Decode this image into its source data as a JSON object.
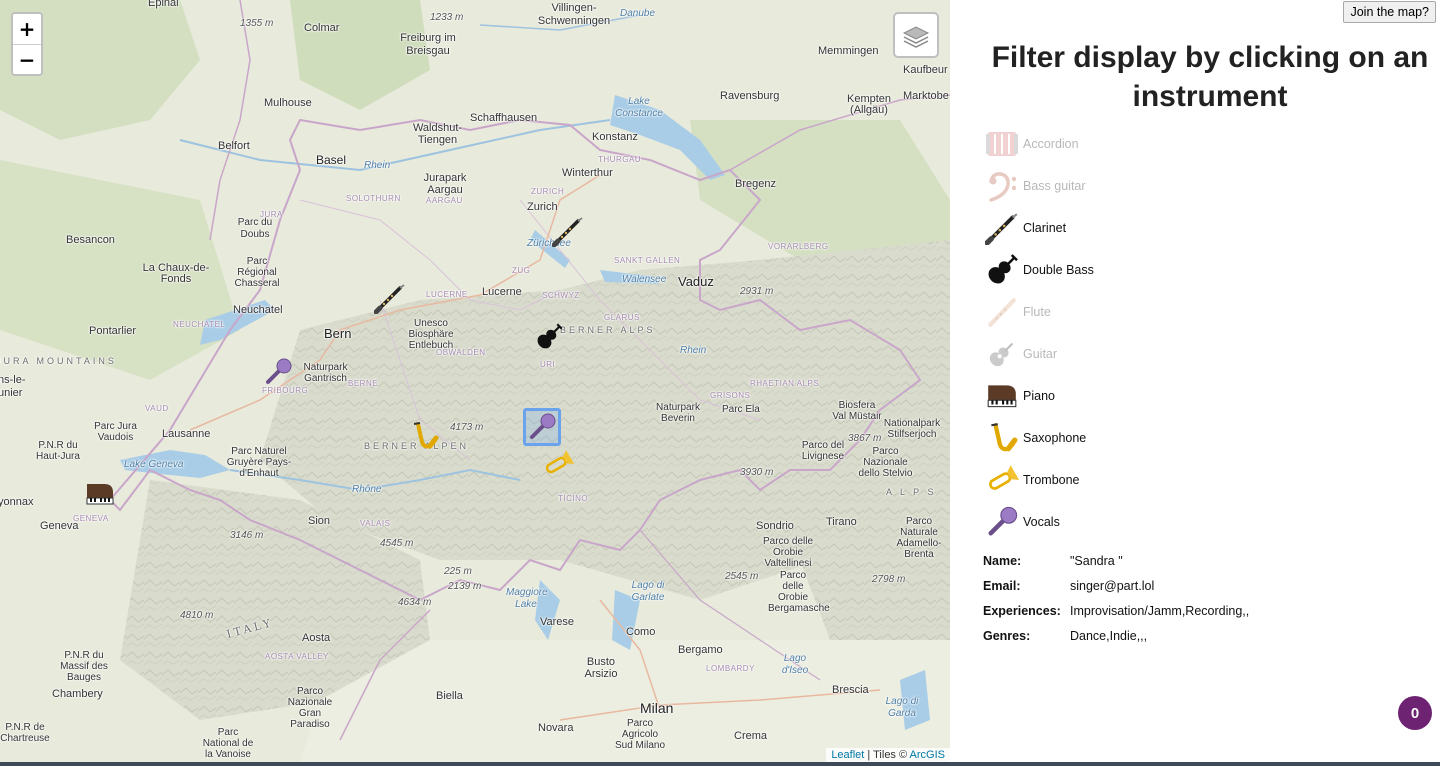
{
  "map": {
    "zoom_in": "+",
    "zoom_out": "−",
    "attribution": {
      "link1": "Leaflet",
      "sep": " | Tiles © ",
      "link2": "ArcGIS"
    },
    "labels": {
      "epinal": "Epinal",
      "colmar": "Colmar",
      "freiburg": "Freiburg im Breisgau",
      "villingen": "Villingen-Schwenningen",
      "donau": "Danube",
      "memmingen": "Memmingen",
      "kaufbeuren": "Kaufbeur",
      "mulhouse": "Mulhouse",
      "ravensburg": "Ravensburg",
      "kempten": "Kempten (Allgäu)",
      "marktober": "Marktobe",
      "lake_constance": "Lake Constance",
      "schaffhausen": "Schaffhausen",
      "waldshut": "Waldshut-Tiengen",
      "konstanz": "Konstanz",
      "belfort": "Belfort",
      "basel": "Basel",
      "rhein": "Rhein",
      "thurgau": "THURGAU",
      "winterthur": "Winterthur",
      "jurapark": "Jurapark Aargau",
      "aargau": "AARGAU",
      "zurich_r": "ZURICH",
      "bregenz": "Bregenz",
      "zurich": "Zurich",
      "solothurn": "SOLOTHURN",
      "jura": "JURA",
      "parc_doubs": "Parc du Doubs",
      "besancon": "Besancon",
      "zurichsee": "Zürichsee",
      "vorarlberg": "VORARLBERG",
      "sankt_gallen": "SANKT GALLEN",
      "chauxdefonds": "La Chaux-de-Fonds",
      "parc_chasseral": "Parc Régional Chasseral",
      "zug": "ZUG",
      "walensee": "Walensee",
      "vaduz": "Vaduz",
      "peak_2931": "2931 m",
      "lucerne_r": "LUCERNE",
      "lucerne": "Lucerne",
      "schwyz": "SCHWYZ",
      "neuchatel": "Neuchatel",
      "pontarlier": "Pontarlier",
      "neuchatel_r": "NEUCHATEL",
      "unesco": "Unesco Biosphäre Entlebuch",
      "bern": "Bern",
      "glarus": "GLARUS",
      "berner_alps": "BERNER ALPS",
      "obwalden": "OBWALDEN",
      "jura_mtns": "JURA MOUNTAINS",
      "rhein2": "Rhein",
      "naturpark_gantrisch": "Naturpark Gantrisch",
      "fribourg": "FRIBOURG",
      "uri": "URI",
      "rhaetian": "RHAETIAN ALPS",
      "vaud": "VAUD",
      "berne_r": "BERNE",
      "grisons": "GRISONS",
      "bioferta": "Biosfera Val Müstair",
      "nationalpark": "Nationalpark Stilfserjoch",
      "parc_jura_vaudois": "Parc Jura Vaudois",
      "lausanne": "Lausanne",
      "peak_4173": "4173 m",
      "berner_alpen": "BERNER ALPEN",
      "naturpark_beverin": "Naturpark Beverin",
      "parc_ela": "Parc Ela",
      "peak_3867": "3867 m",
      "parc_livignese": "Parco del Livignese",
      "parco_stelvio": "Parco Nazionale dello Stelvio",
      "pnr_haut_jura": "P.N.R du Haut-Jura",
      "lake_geneva": "Lake Geneva",
      "parc_gruyere": "Parc Naturel Gruyère Pays-d'Enhaut",
      "rhone": "Rhône",
      "peak_3930": "3930 m",
      "alps": "A L P S",
      "vonnax": "yonnax",
      "geneva": "Geneva",
      "geneva_r": "GENEVA",
      "ticino": "TICINO",
      "sion": "Sion",
      "valais": "VALAIS",
      "sondrio": "Sondrio",
      "tirano": "Tirano",
      "parco_adamello": "Parco Naturale Adamello-Brenta",
      "peak_3146": "3146 m",
      "peak_4545": "4545 m",
      "parco_orobie": "Parco delle Orobie Valtellinesi",
      "peak_225": "225 m",
      "peak_2139": "2139 m",
      "peak_2545": "2545 m",
      "parco_bergamasche": "Parco delle Orobie Bergamasche",
      "peak_2798": "2798 m",
      "peak_4634": "4634 m",
      "maggiore": "Maggiore Lake",
      "lago_garlate": "Lago di Garlate",
      "peak_4810": "4810 m",
      "italy": "ITALY",
      "varese": "Varese",
      "como": "Como",
      "aosta": "Aosta",
      "aosta_valley": "AOSTA VALLEY",
      "pnr_bauges": "P.N.R du Massif des Bauges",
      "bergamo": "Bergamo",
      "lago_iseo": "Lago d'Iseo",
      "busto": "Busto Arsizio",
      "lombardy": "LOMBARDY",
      "chambery": "Chambery",
      "biella": "Biella",
      "brescia": "Brescia",
      "lago_garda": "Lago di Garda",
      "parco_paradiso": "Parco Nazionale Gran Paradiso",
      "milan": "Milan",
      "pnr_chartreuse": "P.N.R de Chartreuse",
      "parco_vanoise": "Parc National de la Vanoise",
      "novara": "Novara",
      "parco_sud": "Parco Agricolo Sud Milano",
      "crema": "Crema",
      "peak_1355": "1355 m",
      "peak_1233": "1233 m",
      "mont_le": "ns-le-",
      "unier": "unier"
    }
  },
  "sidebar": {
    "join_button": "Join the map?",
    "title": "Filter display by clicking on an instrument",
    "instruments": [
      {
        "label": "Accordion",
        "icon": "accordion-icon",
        "active": false
      },
      {
        "label": "Bass guitar",
        "icon": "bass-clef-icon",
        "active": false
      },
      {
        "label": "Clarinet",
        "icon": "clarinet-icon",
        "active": true
      },
      {
        "label": "Double Bass",
        "icon": "violin-icon",
        "active": true
      },
      {
        "label": "Flute",
        "icon": "flute-icon",
        "active": false
      },
      {
        "label": "Guitar",
        "icon": "guitar-icon",
        "active": false
      },
      {
        "label": "Piano",
        "icon": "piano-icon",
        "active": true
      },
      {
        "label": "Saxophone",
        "icon": "saxophone-icon",
        "active": true
      },
      {
        "label": "Trombone",
        "icon": "trombone-icon",
        "active": true
      },
      {
        "label": "Vocals",
        "icon": "microphone-icon",
        "active": true
      }
    ],
    "info": {
      "name_label": "Name:",
      "name_value": "\"Sandra \"",
      "email_label": "Email:",
      "email_value": "singer@part.lol",
      "experiences_label": "Experiences:",
      "experiences_value": "Improvisation/Jamm,Recording,,",
      "genres_label": "Genres:",
      "genres_value": "Dance,Indie,,,"
    },
    "badge_count": "0"
  },
  "colors": {
    "accent": "#6d2272",
    "selection": "#6aa3ec",
    "border": "#c9a6c9"
  }
}
